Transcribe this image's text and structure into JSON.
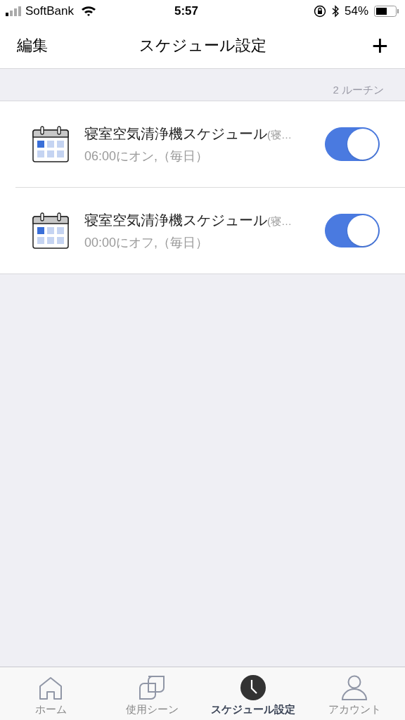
{
  "status_bar": {
    "carrier": "SoftBank",
    "time": "5:57",
    "battery": "54%"
  },
  "nav": {
    "left": "編集",
    "title": "スケジュール設定",
    "right": "+"
  },
  "count": "2 ルーチン",
  "schedules": [
    {
      "title": "寝室空気清浄機スケジュール",
      "title_suffix": "(寝…",
      "detail": "06:00にオン,（毎日）",
      "on": true
    },
    {
      "title": "寝室空気清浄機スケジュール",
      "title_suffix": "(寝…",
      "detail": "00:00にオフ,（毎日）",
      "on": true
    }
  ],
  "tabs": [
    {
      "kind": "home",
      "label": "ホーム",
      "selected": false
    },
    {
      "kind": "scenes",
      "label": "使用シーン",
      "selected": false
    },
    {
      "kind": "schedule",
      "label": "スケジュール設定",
      "selected": true
    },
    {
      "kind": "account",
      "label": "アカウント",
      "selected": false
    }
  ]
}
